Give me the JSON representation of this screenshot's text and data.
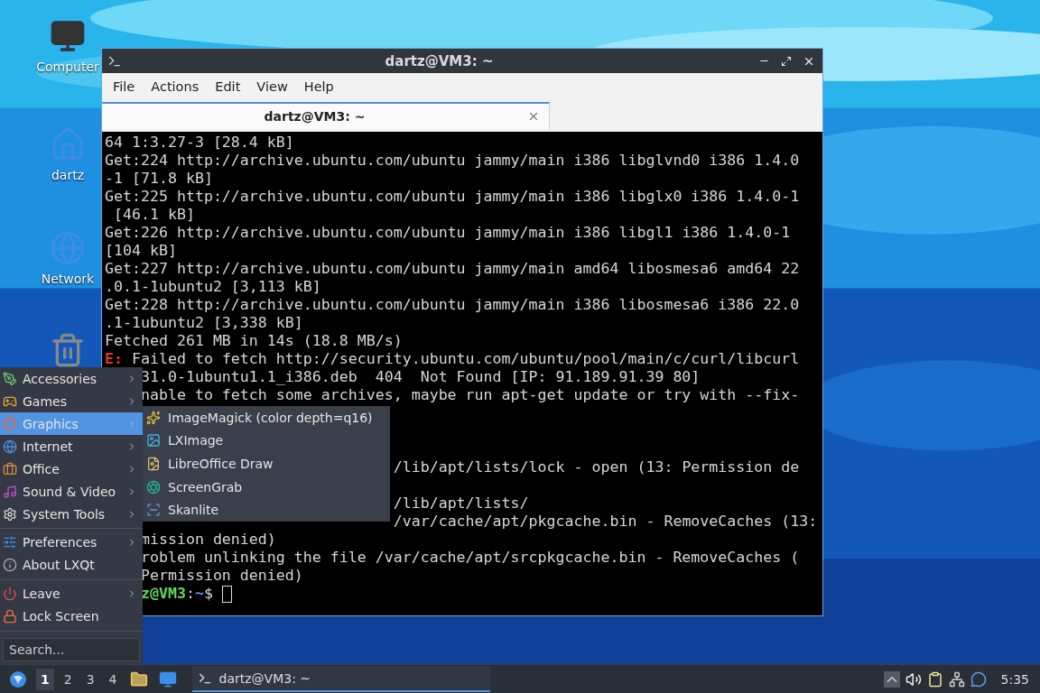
{
  "desktop_icons": [
    {
      "kind": "computer",
      "label": "Computer"
    },
    {
      "kind": "home",
      "label": "dartz"
    },
    {
      "kind": "network",
      "label": "Network"
    },
    {
      "kind": "trash"
    }
  ],
  "window": {
    "title": "dartz@VM3: ~",
    "menu": [
      "File",
      "Actions",
      "Edit",
      "View",
      "Help"
    ],
    "tabs": [
      {
        "label": "dartz@VM3: ~",
        "selected": true
      }
    ],
    "terminal_lines": [
      {
        "kind": "plain",
        "text": "64 1:3.27-3 [28.4 kB]"
      },
      {
        "kind": "plain",
        "text": "Get:224 http://archive.ubuntu.com/ubuntu jammy/main i386 libglvnd0 i386 1.4.0"
      },
      {
        "kind": "plain",
        "text": "-1 [71.8 kB]"
      },
      {
        "kind": "plain",
        "text": "Get:225 http://archive.ubuntu.com/ubuntu jammy/main i386 libglx0 i386 1.4.0-1"
      },
      {
        "kind": "plain",
        "text": " [46.1 kB]"
      },
      {
        "kind": "plain",
        "text": "Get:226 http://archive.ubuntu.com/ubuntu jammy/main i386 libgl1 i386 1.4.0-1"
      },
      {
        "kind": "plain",
        "text": "[104 kB]"
      },
      {
        "kind": "plain",
        "text": "Get:227 http://archive.ubuntu.com/ubuntu jammy/main amd64 libosmesa6 amd64 22"
      },
      {
        "kind": "plain",
        "text": ".0.1-1ubuntu2 [3,113 kB]"
      },
      {
        "kind": "plain",
        "text": "Get:228 http://archive.ubuntu.com/ubuntu jammy/main i386 libosmesa6 i386 22.0"
      },
      {
        "kind": "plain",
        "text": ".1-1ubuntu2 [3,338 kB]"
      },
      {
        "kind": "plain",
        "text": "Fetched 261 MB in 14s (18.8 MB/s)"
      },
      {
        "kind": "error",
        "prefix": "E:",
        "text": " Failed to fetch http://security.ubuntu.com/ubuntu/pool/main/c/curl/libcurl"
      },
      {
        "kind": "clipped_menu",
        "text": "31.0-1ubuntu1.1_i386.deb  404  Not Found [IP: 91.189.91.39 80]"
      },
      {
        "kind": "clipped_menu",
        "text": "nable to fetch some archives, maybe run apt-get update or try with --fix-"
      },
      {
        "kind": "covered"
      },
      {
        "kind": "covered"
      },
      {
        "kind": "covered"
      },
      {
        "kind": "clipped_submenu",
        "text": "/lib/apt/lists/lock - open (13: Permission de"
      },
      {
        "kind": "covered"
      },
      {
        "kind": "clipped_submenu",
        "text": "/lib/apt/lists/"
      },
      {
        "kind": "clipped_submenu",
        "text": "/var/cache/apt/pkgcache.bin - RemoveCaches (13:"
      },
      {
        "kind": "clipped_menu",
        "text": "mission denied)"
      },
      {
        "kind": "clipped_menu",
        "text": "roblem unlinking the file /var/cache/apt/srcpkgcache.bin - RemoveCaches ("
      },
      {
        "kind": "clipped_menu",
        "text": "Permission denied)"
      },
      {
        "kind": "prompt",
        "parts": [
          {
            "kind": "user",
            "text": "z@VM3"
          },
          {
            "kind": "plain",
            "text": ":"
          },
          {
            "kind": "path",
            "text": "~"
          },
          {
            "kind": "plain",
            "text": "$"
          }
        ]
      }
    ]
  },
  "start_menu": {
    "groups": [
      {
        "items": [
          {
            "label": "Accessories",
            "submenu": true,
            "selected": false
          },
          {
            "label": "Games",
            "submenu": true,
            "selected": false
          },
          {
            "label": "Graphics",
            "submenu": true,
            "selected": true
          },
          {
            "label": "Internet",
            "submenu": true,
            "selected": false
          },
          {
            "label": "Office",
            "submenu": true,
            "selected": false
          },
          {
            "label": "Sound & Video",
            "submenu": true,
            "selected": false
          },
          {
            "label": "System Tools",
            "submenu": true,
            "selected": false
          }
        ]
      },
      {
        "items": [
          {
            "label": "Preferences",
            "submenu": true,
            "selected": false
          },
          {
            "label": "About LXQt",
            "submenu": false,
            "selected": false
          }
        ]
      },
      {
        "items": [
          {
            "label": "Leave",
            "submenu": true,
            "selected": false
          },
          {
            "label": "Lock Screen",
            "submenu": false,
            "selected": false
          }
        ]
      }
    ],
    "search": {
      "placeholder": "Search..."
    }
  },
  "submenu": {
    "items": [
      {
        "label": "ImageMagick (color depth=q16)"
      },
      {
        "label": "LXImage"
      },
      {
        "label": "LibreOffice Draw"
      },
      {
        "label": "ScreenGrab"
      },
      {
        "label": "Skanlite"
      }
    ]
  },
  "taskbar": {
    "workspaces": [
      {
        "label": "1",
        "selected": true
      },
      {
        "label": "2",
        "selected": false
      },
      {
        "label": "3",
        "selected": false
      },
      {
        "label": "4",
        "selected": false
      }
    ],
    "tasks": [
      {
        "label": "dartz@VM3: ~",
        "selected": true
      }
    ],
    "clock": "5:35"
  }
}
